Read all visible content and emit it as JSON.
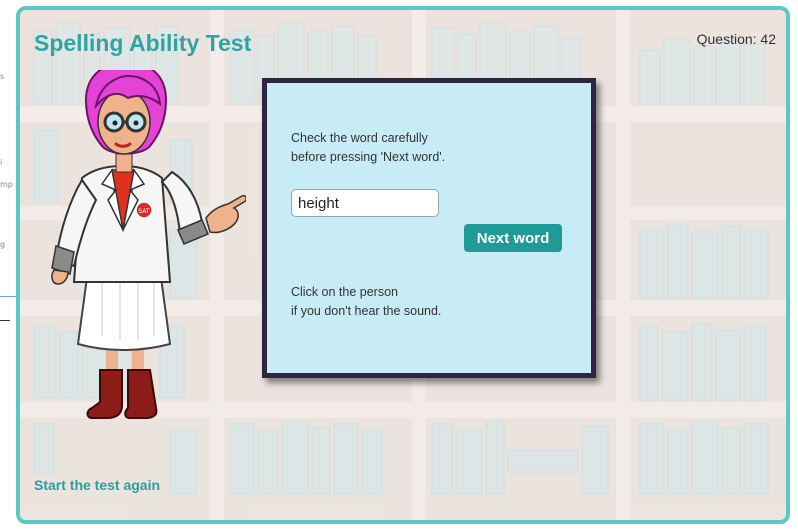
{
  "page": {
    "title": "Spelling Ability Test",
    "question_label": "Question: 42",
    "restart_link": "Start the test again"
  },
  "dialog": {
    "instruction_line1": "Check the word carefully",
    "instruction_line2": "before pressing 'Next word'.",
    "answer_value": "height",
    "next_button": "Next word",
    "hint_line1": "Click on the person",
    "hint_line2": "if you don't hear the sound."
  },
  "teacher": {
    "badge_text": "SAT"
  },
  "side_strip": [
    "s",
    "i",
    "mp",
    "g"
  ],
  "colors": {
    "frame_border": "#5ec7c4",
    "title": "#2fa5a3",
    "dialog_bg": "#c8ecf5",
    "dialog_border": "#2f2540",
    "button_bg": "#1f9a96"
  }
}
